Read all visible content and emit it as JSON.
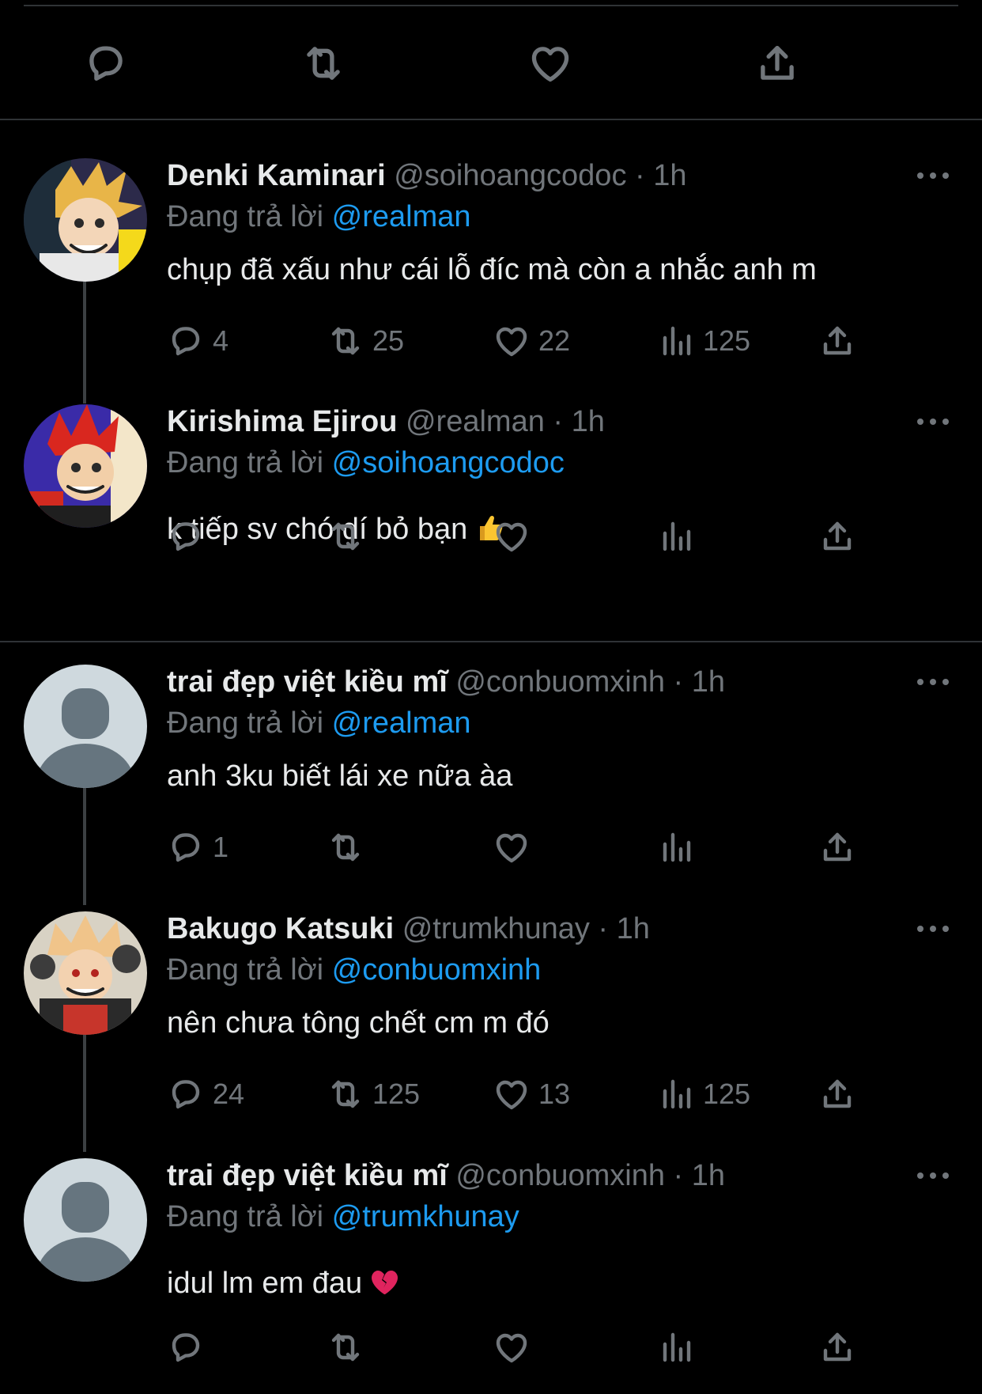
{
  "reply_prefix": "Đang trả lời ",
  "separator": "·",
  "tweets": [
    {
      "name": "Denki Kaminari",
      "handle": "@soihoangcodoc",
      "time": "1h",
      "reply_to": "@realman",
      "text": "chụp đã xấu như cái lỗ đíc mà còn a nhắc anh m",
      "replies": "4",
      "retweets": "25",
      "likes": "22",
      "views": "125"
    },
    {
      "name": "Kirishima Ejirou",
      "handle": "@realman",
      "time": "1h",
      "reply_to": "@soihoangcodoc",
      "text": "k tiếp sv chó dí bỏ bạn",
      "emoji": "thumbs-up",
      "replies": "",
      "retweets": "",
      "likes": "",
      "views": ""
    },
    {
      "name": "trai đẹp việt kiều mĩ",
      "handle": "@conbuomxinh",
      "time": "1h",
      "reply_to": "@realman",
      "text": "anh 3ku biết lái xe nữa àa",
      "replies": "1",
      "retweets": "",
      "likes": "",
      "views": ""
    },
    {
      "name": "Bakugo Katsuki",
      "handle": "@trumkhunay",
      "time": "1h",
      "reply_to": "@conbuomxinh",
      "text": "nên chưa tông chết cm m đó",
      "replies": "24",
      "retweets": "125",
      "likes": "13",
      "views": "125"
    },
    {
      "name": "trai đẹp việt kiều mĩ",
      "handle": "@conbuomxinh",
      "time": "1h",
      "reply_to": "@trumkhunay",
      "text": "idul lm em đau",
      "emoji": "broken-heart",
      "replies": "",
      "retweets": "",
      "likes": "",
      "views": ""
    }
  ],
  "colors": {
    "background": "#000000",
    "text": "#e7e9ea",
    "muted": "#71767b",
    "link": "#1d9bf0",
    "divider": "#2f3336"
  }
}
